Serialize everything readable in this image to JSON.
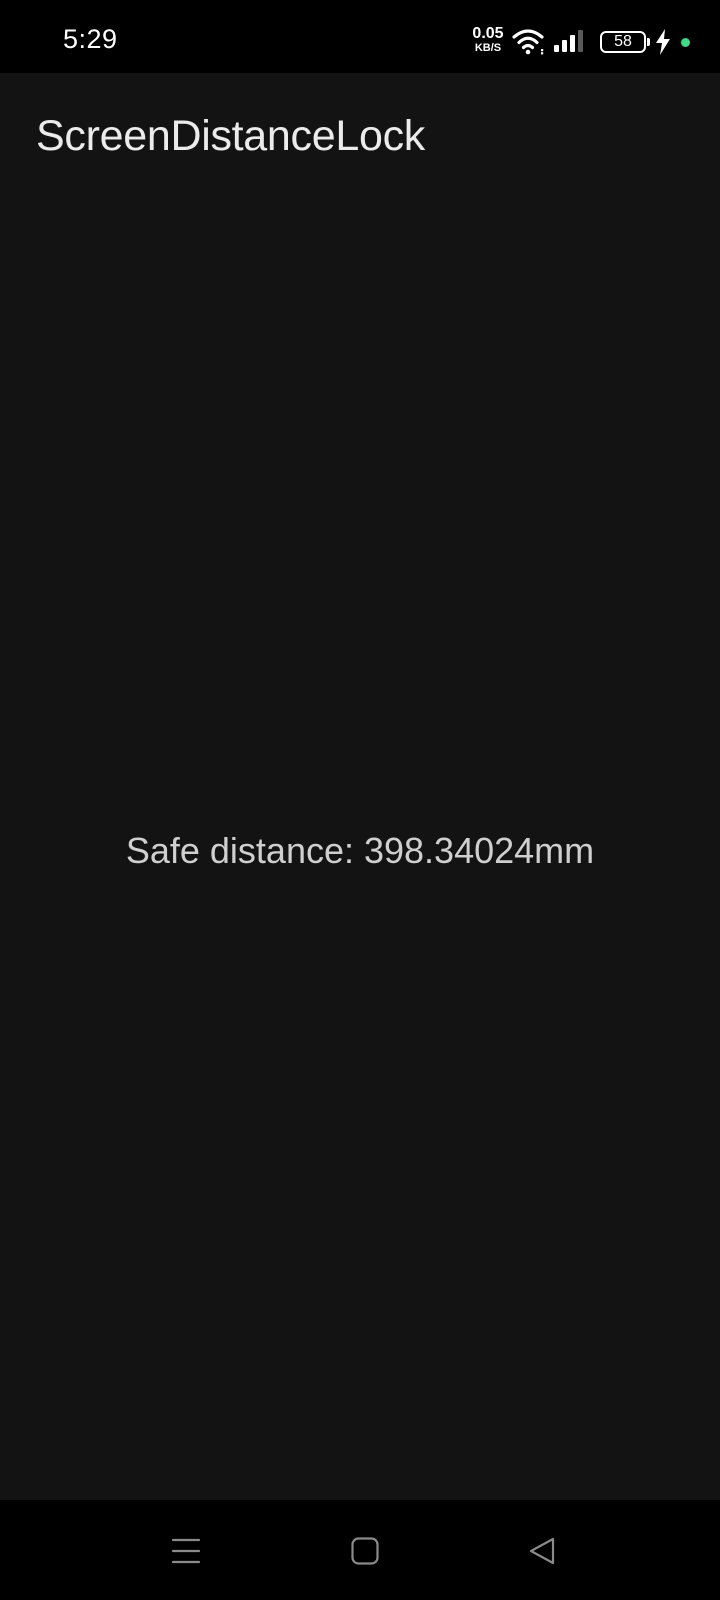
{
  "status_bar": {
    "time": "5:29",
    "net_speed_value": "0.05",
    "net_speed_unit": "KB/S",
    "battery_level": "58",
    "icons": {
      "wifi": "wifi-icon",
      "signal": "cellular-signal-icon",
      "charging": "charging-bolt-icon",
      "indicator": "green-dot-indicator"
    },
    "indicator_color": "#3ddc84"
  },
  "app_bar": {
    "title": "ScreenDistanceLock"
  },
  "main": {
    "distance_text": "Safe distance: 398.34024mm"
  },
  "nav_bar": {
    "icons": {
      "menu": "recent-apps-icon",
      "home": "home-icon",
      "back": "back-icon"
    }
  },
  "colors": {
    "background": "#131313",
    "system_bars": "#000000",
    "title_text": "#ebebeb",
    "body_text": "#cfcfcf"
  }
}
